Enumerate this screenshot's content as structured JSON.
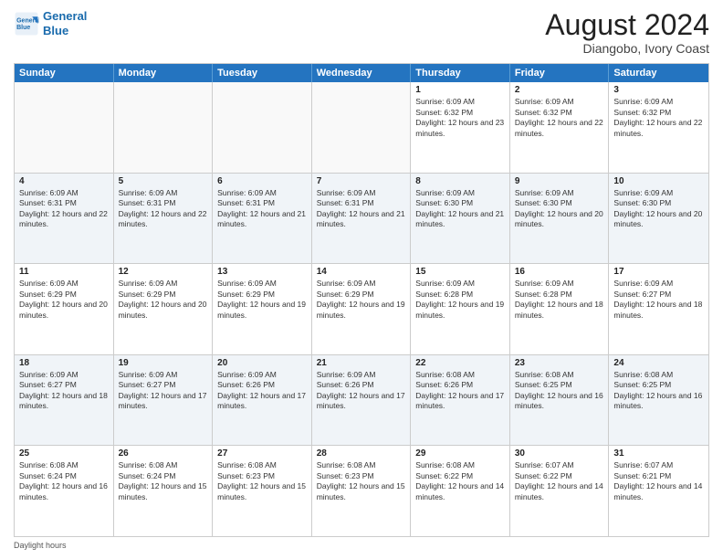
{
  "logo": {
    "line1": "General",
    "line2": "Blue"
  },
  "title": "August 2024",
  "subtitle": "Diangobo, Ivory Coast",
  "days_of_week": [
    "Sunday",
    "Monday",
    "Tuesday",
    "Wednesday",
    "Thursday",
    "Friday",
    "Saturday"
  ],
  "footer": "Daylight hours",
  "weeks": [
    [
      {
        "day": "",
        "sunrise": "",
        "sunset": "",
        "daylight": "",
        "empty": true
      },
      {
        "day": "",
        "sunrise": "",
        "sunset": "",
        "daylight": "",
        "empty": true
      },
      {
        "day": "",
        "sunrise": "",
        "sunset": "",
        "daylight": "",
        "empty": true
      },
      {
        "day": "",
        "sunrise": "",
        "sunset": "",
        "daylight": "",
        "empty": true
      },
      {
        "day": "1",
        "sunrise": "Sunrise: 6:09 AM",
        "sunset": "Sunset: 6:32 PM",
        "daylight": "Daylight: 12 hours and 23 minutes."
      },
      {
        "day": "2",
        "sunrise": "Sunrise: 6:09 AM",
        "sunset": "Sunset: 6:32 PM",
        "daylight": "Daylight: 12 hours and 22 minutes."
      },
      {
        "day": "3",
        "sunrise": "Sunrise: 6:09 AM",
        "sunset": "Sunset: 6:32 PM",
        "daylight": "Daylight: 12 hours and 22 minutes."
      }
    ],
    [
      {
        "day": "4",
        "sunrise": "Sunrise: 6:09 AM",
        "sunset": "Sunset: 6:31 PM",
        "daylight": "Daylight: 12 hours and 22 minutes."
      },
      {
        "day": "5",
        "sunrise": "Sunrise: 6:09 AM",
        "sunset": "Sunset: 6:31 PM",
        "daylight": "Daylight: 12 hours and 22 minutes."
      },
      {
        "day": "6",
        "sunrise": "Sunrise: 6:09 AM",
        "sunset": "Sunset: 6:31 PM",
        "daylight": "Daylight: 12 hours and 21 minutes."
      },
      {
        "day": "7",
        "sunrise": "Sunrise: 6:09 AM",
        "sunset": "Sunset: 6:31 PM",
        "daylight": "Daylight: 12 hours and 21 minutes."
      },
      {
        "day": "8",
        "sunrise": "Sunrise: 6:09 AM",
        "sunset": "Sunset: 6:30 PM",
        "daylight": "Daylight: 12 hours and 21 minutes."
      },
      {
        "day": "9",
        "sunrise": "Sunrise: 6:09 AM",
        "sunset": "Sunset: 6:30 PM",
        "daylight": "Daylight: 12 hours and 20 minutes."
      },
      {
        "day": "10",
        "sunrise": "Sunrise: 6:09 AM",
        "sunset": "Sunset: 6:30 PM",
        "daylight": "Daylight: 12 hours and 20 minutes."
      }
    ],
    [
      {
        "day": "11",
        "sunrise": "Sunrise: 6:09 AM",
        "sunset": "Sunset: 6:29 PM",
        "daylight": "Daylight: 12 hours and 20 minutes."
      },
      {
        "day": "12",
        "sunrise": "Sunrise: 6:09 AM",
        "sunset": "Sunset: 6:29 PM",
        "daylight": "Daylight: 12 hours and 20 minutes."
      },
      {
        "day": "13",
        "sunrise": "Sunrise: 6:09 AM",
        "sunset": "Sunset: 6:29 PM",
        "daylight": "Daylight: 12 hours and 19 minutes."
      },
      {
        "day": "14",
        "sunrise": "Sunrise: 6:09 AM",
        "sunset": "Sunset: 6:29 PM",
        "daylight": "Daylight: 12 hours and 19 minutes."
      },
      {
        "day": "15",
        "sunrise": "Sunrise: 6:09 AM",
        "sunset": "Sunset: 6:28 PM",
        "daylight": "Daylight: 12 hours and 19 minutes."
      },
      {
        "day": "16",
        "sunrise": "Sunrise: 6:09 AM",
        "sunset": "Sunset: 6:28 PM",
        "daylight": "Daylight: 12 hours and 18 minutes."
      },
      {
        "day": "17",
        "sunrise": "Sunrise: 6:09 AM",
        "sunset": "Sunset: 6:27 PM",
        "daylight": "Daylight: 12 hours and 18 minutes."
      }
    ],
    [
      {
        "day": "18",
        "sunrise": "Sunrise: 6:09 AM",
        "sunset": "Sunset: 6:27 PM",
        "daylight": "Daylight: 12 hours and 18 minutes."
      },
      {
        "day": "19",
        "sunrise": "Sunrise: 6:09 AM",
        "sunset": "Sunset: 6:27 PM",
        "daylight": "Daylight: 12 hours and 17 minutes."
      },
      {
        "day": "20",
        "sunrise": "Sunrise: 6:09 AM",
        "sunset": "Sunset: 6:26 PM",
        "daylight": "Daylight: 12 hours and 17 minutes."
      },
      {
        "day": "21",
        "sunrise": "Sunrise: 6:09 AM",
        "sunset": "Sunset: 6:26 PM",
        "daylight": "Daylight: 12 hours and 17 minutes."
      },
      {
        "day": "22",
        "sunrise": "Sunrise: 6:08 AM",
        "sunset": "Sunset: 6:26 PM",
        "daylight": "Daylight: 12 hours and 17 minutes."
      },
      {
        "day": "23",
        "sunrise": "Sunrise: 6:08 AM",
        "sunset": "Sunset: 6:25 PM",
        "daylight": "Daylight: 12 hours and 16 minutes."
      },
      {
        "day": "24",
        "sunrise": "Sunrise: 6:08 AM",
        "sunset": "Sunset: 6:25 PM",
        "daylight": "Daylight: 12 hours and 16 minutes."
      }
    ],
    [
      {
        "day": "25",
        "sunrise": "Sunrise: 6:08 AM",
        "sunset": "Sunset: 6:24 PM",
        "daylight": "Daylight: 12 hours and 16 minutes."
      },
      {
        "day": "26",
        "sunrise": "Sunrise: 6:08 AM",
        "sunset": "Sunset: 6:24 PM",
        "daylight": "Daylight: 12 hours and 15 minutes."
      },
      {
        "day": "27",
        "sunrise": "Sunrise: 6:08 AM",
        "sunset": "Sunset: 6:23 PM",
        "daylight": "Daylight: 12 hours and 15 minutes."
      },
      {
        "day": "28",
        "sunrise": "Sunrise: 6:08 AM",
        "sunset": "Sunset: 6:23 PM",
        "daylight": "Daylight: 12 hours and 15 minutes."
      },
      {
        "day": "29",
        "sunrise": "Sunrise: 6:08 AM",
        "sunset": "Sunset: 6:22 PM",
        "daylight": "Daylight: 12 hours and 14 minutes."
      },
      {
        "day": "30",
        "sunrise": "Sunrise: 6:07 AM",
        "sunset": "Sunset: 6:22 PM",
        "daylight": "Daylight: 12 hours and 14 minutes."
      },
      {
        "day": "31",
        "sunrise": "Sunrise: 6:07 AM",
        "sunset": "Sunset: 6:21 PM",
        "daylight": "Daylight: 12 hours and 14 minutes."
      }
    ]
  ]
}
